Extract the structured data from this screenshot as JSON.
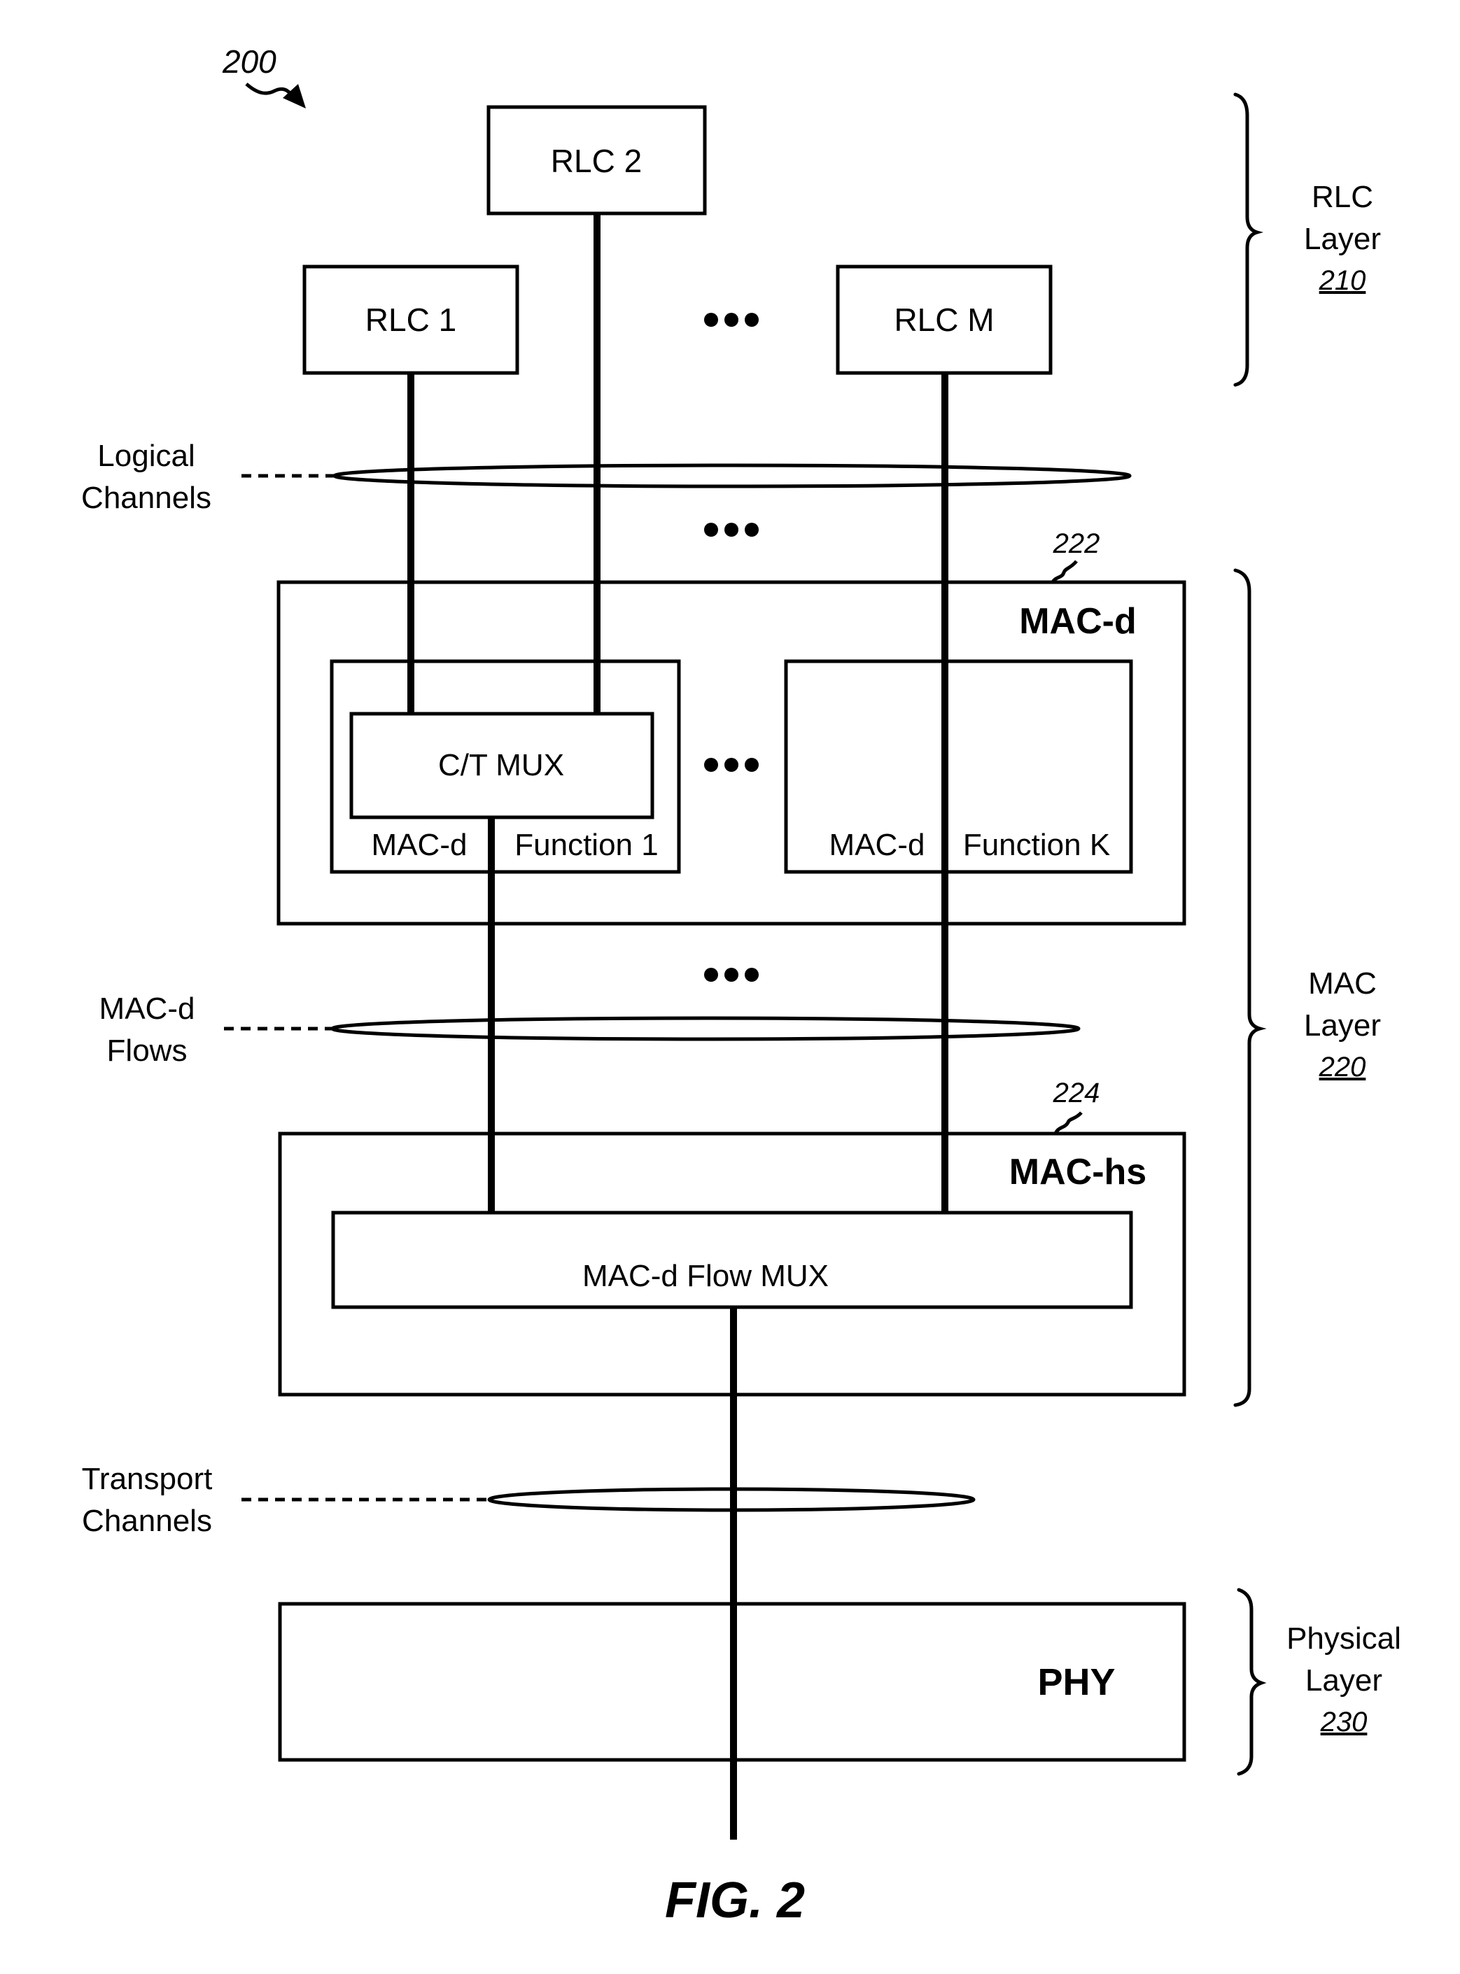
{
  "figure": {
    "reference_number": "200",
    "caption": "FIG. 2"
  },
  "rlc": {
    "entities": [
      "RLC 1",
      "RLC 2",
      "RLC M"
    ],
    "ellipsis": "•••"
  },
  "channels": {
    "logical": [
      "Logical",
      "Channels"
    ],
    "macd_flows": [
      "MAC-d",
      "Flows"
    ],
    "transport": [
      "Transport",
      "Channels"
    ]
  },
  "mac_d": {
    "title": "MAC-d",
    "ref": "222",
    "ct_mux": "C/T MUX",
    "function1": [
      "MAC-d",
      "Function 1"
    ],
    "functionK": [
      "MAC-d",
      "Function K"
    ]
  },
  "mac_hs": {
    "title": "MAC-hs",
    "ref": "224",
    "flow_mux": "MAC-d Flow MUX"
  },
  "phy": {
    "title": "PHY"
  },
  "layers": {
    "rlc": [
      "RLC",
      "Layer",
      "210"
    ],
    "mac": [
      "MAC",
      "Layer",
      "220"
    ],
    "physical": [
      "Physical",
      "Layer",
      "230"
    ]
  }
}
